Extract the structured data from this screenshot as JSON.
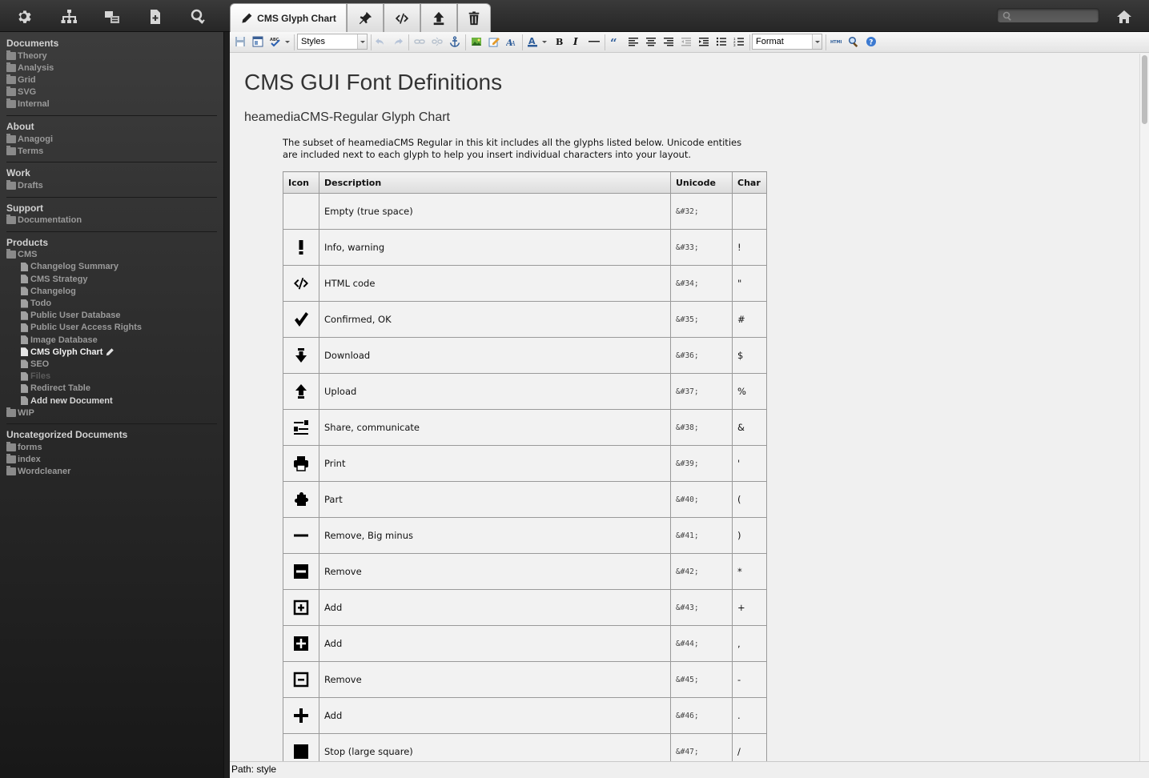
{
  "topbar": {
    "icons": [
      "gear-icon",
      "sitemap-icon",
      "translate-icon",
      "new-document-icon",
      "search-key-icon"
    ],
    "search_placeholder": "",
    "home_icon": "home-icon"
  },
  "tabs": [
    {
      "label": "CMS Glyph Chart",
      "icon": "pencil-icon",
      "active": true
    },
    {
      "label": "",
      "icon": "pin-icon"
    },
    {
      "label": "",
      "icon": "code-icon"
    },
    {
      "label": "",
      "icon": "upload-icon"
    },
    {
      "label": "",
      "icon": "trash-icon"
    }
  ],
  "sidebar": {
    "sections": [
      {
        "title": "Documents",
        "items": [
          {
            "label": "Theory",
            "type": "folder"
          },
          {
            "label": "Analysis",
            "type": "folder"
          },
          {
            "label": "Grid",
            "type": "folder"
          },
          {
            "label": "SVG",
            "type": "folder"
          },
          {
            "label": "Internal",
            "type": "folder"
          }
        ]
      },
      {
        "title": "About",
        "items": [
          {
            "label": "Anagogi",
            "type": "folder"
          },
          {
            "label": "Terms",
            "type": "folder"
          }
        ]
      },
      {
        "title": "Work",
        "items": [
          {
            "label": "Drafts",
            "type": "folder"
          }
        ]
      },
      {
        "title": "Support",
        "items": [
          {
            "label": "Documentation",
            "type": "folder"
          }
        ]
      },
      {
        "title": "Products",
        "items": [
          {
            "label": "CMS",
            "type": "folder-open"
          },
          {
            "label": "Changelog Summary",
            "type": "doc",
            "indent": true
          },
          {
            "label": "CMS Strategy",
            "type": "doc",
            "indent": true
          },
          {
            "label": "Changelog",
            "type": "doc",
            "indent": true
          },
          {
            "label": "Todo",
            "type": "doc",
            "indent": true
          },
          {
            "label": "Public User Database",
            "type": "doc",
            "indent": true
          },
          {
            "label": "Public User Access Rights",
            "type": "doc",
            "indent": true
          },
          {
            "label": "Image Database",
            "type": "doc",
            "indent": true
          },
          {
            "label": "CMS Glyph Chart",
            "type": "doc",
            "indent": true,
            "active": true
          },
          {
            "label": "SEO",
            "type": "doc",
            "indent": true
          },
          {
            "label": "Files",
            "type": "doc",
            "indent": true,
            "dim": true
          },
          {
            "label": "Redirect Table",
            "type": "doc",
            "indent": true
          },
          {
            "label": "Add new Document",
            "type": "doc",
            "indent": true,
            "add": true
          },
          {
            "label": "WIP",
            "type": "folder"
          }
        ]
      },
      {
        "title": "Uncategorized Documents",
        "items": [
          {
            "label": "forms",
            "type": "folder"
          },
          {
            "label": "index",
            "type": "folder"
          },
          {
            "label": "Wordcleaner",
            "type": "folder"
          }
        ]
      }
    ]
  },
  "toolbar": {
    "styles_label": "Styles",
    "format_label": "Format"
  },
  "document": {
    "title": "CMS GUI Font Definitions",
    "subtitle": "heamediaCMS-Regular Glyph Chart",
    "intro": "The subset of heamediaCMS Regular in this kit includes all the glyphs listed below. Unicode entities are included next to each glyph to help you insert individual characters into your layout.",
    "table": {
      "headers": [
        "Icon",
        "Description",
        "Unicode",
        "Char"
      ],
      "rows": [
        {
          "icon": "",
          "desc": "Empty (true space)",
          "unicode": "&#32;",
          "char": ""
        },
        {
          "icon": "exclamation-icon",
          "desc": "Info, warning",
          "unicode": "&#33;",
          "char": "!"
        },
        {
          "icon": "code-icon",
          "desc": "HTML code",
          "unicode": "&#34;",
          "char": "\""
        },
        {
          "icon": "checkmark-icon",
          "desc": "Confirmed, OK",
          "unicode": "&#35;",
          "char": "#"
        },
        {
          "icon": "download-icon",
          "desc": "Download",
          "unicode": "&#36;",
          "char": "$"
        },
        {
          "icon": "upload-icon",
          "desc": "Upload",
          "unicode": "&#37;",
          "char": "%"
        },
        {
          "icon": "share-icon",
          "desc": "Share, communicate",
          "unicode": "&#38;",
          "char": "&"
        },
        {
          "icon": "print-icon",
          "desc": "Print",
          "unicode": "&#39;",
          "char": "'"
        },
        {
          "icon": "puzzle-icon",
          "desc": "Part",
          "unicode": "&#40;",
          "char": "("
        },
        {
          "icon": "minus-icon",
          "desc": "Remove, Big minus",
          "unicode": "&#41;",
          "char": ")"
        },
        {
          "icon": "minus-square-filled-icon",
          "desc": "Remove",
          "unicode": "&#42;",
          "char": "*"
        },
        {
          "icon": "plus-square-outline-icon",
          "desc": "Add",
          "unicode": "&#43;",
          "char": "+"
        },
        {
          "icon": "plus-square-filled-icon",
          "desc": "Add",
          "unicode": "&#44;",
          "char": ","
        },
        {
          "icon": "minus-square-outline-icon",
          "desc": "Remove",
          "unicode": "&#45;",
          "char": "-"
        },
        {
          "icon": "plus-icon",
          "desc": "Add",
          "unicode": "&#46;",
          "char": "."
        },
        {
          "icon": "stop-square-icon",
          "desc": "Stop (large square)",
          "unicode": "&#47;",
          "char": "/"
        }
      ]
    }
  },
  "statusbar": {
    "path": "Path: style"
  },
  "colors": {
    "sidebar_bg_top": "#3c3c3c",
    "sidebar_bg_bottom": "#181818",
    "editor_bg": "#f0f0f0"
  }
}
